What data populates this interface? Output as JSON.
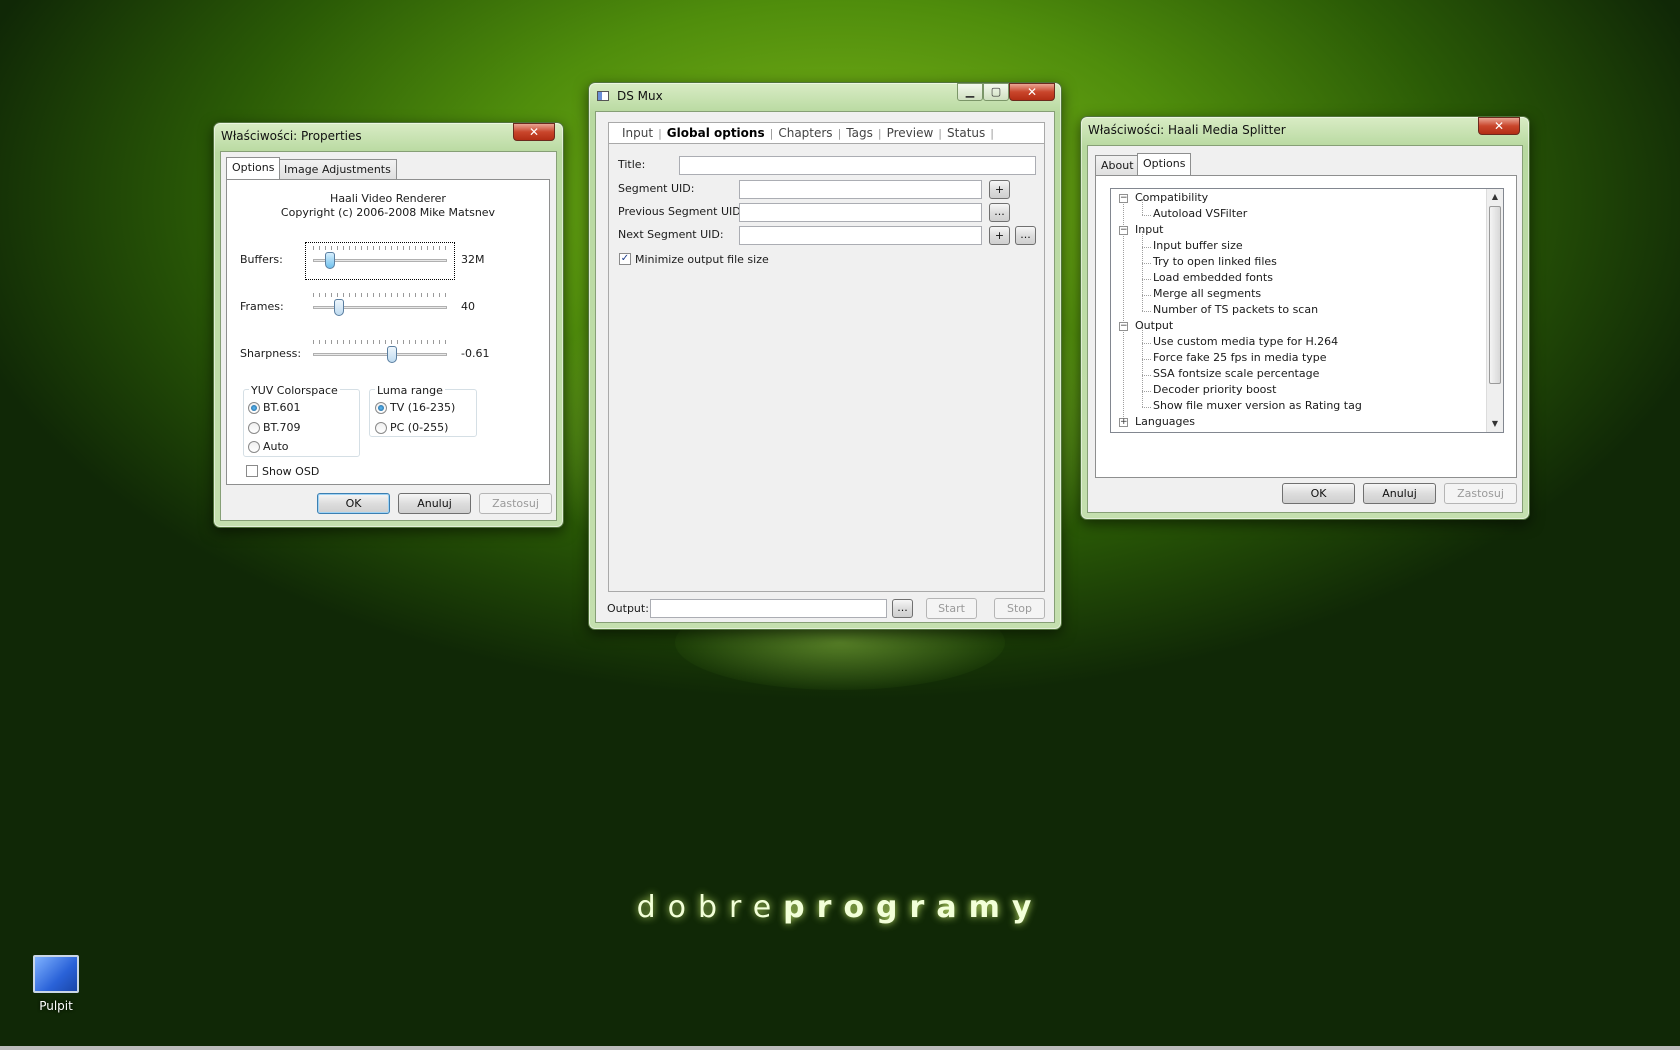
{
  "desktop": {
    "brand_part1": "dobre",
    "brand_part2": "programy",
    "icon_label": "Pulpit"
  },
  "properties_window": {
    "title": "Właściwości: Properties",
    "tabs": [
      "Options",
      "Image Adjustments"
    ],
    "header_line1": "Haali Video Renderer",
    "header_line2": "Copyright (c) 2006-2008 Mike Matsnev",
    "sliders": [
      {
        "label": "Buffers:",
        "value_text": "32M",
        "position": 0.1
      },
      {
        "label": "Frames:",
        "value_text": "40",
        "position": 0.17
      },
      {
        "label": "Sharpness:",
        "value_text": "-0.61",
        "position": 0.6
      }
    ],
    "yuv_group": {
      "label": "YUV Colorspace",
      "options": [
        "BT.601",
        "BT.709",
        "Auto"
      ],
      "selected": "BT.601"
    },
    "luma_group": {
      "label": "Luma range",
      "options": [
        "TV (16-235)",
        "PC (0-255)"
      ],
      "selected": "TV (16-235)"
    },
    "show_osd": {
      "label": "Show OSD",
      "checked": false
    },
    "buttons": {
      "ok": "OK",
      "cancel": "Anuluj",
      "apply": "Zastosuj"
    }
  },
  "dsmux_window": {
    "title": "DS Mux",
    "tabs": [
      "Input",
      "Global options",
      "Chapters",
      "Tags",
      "Preview",
      "Status"
    ],
    "active_tab": "Global options",
    "fields": {
      "title_label": "Title:",
      "segment_uid_label": "Segment UID:",
      "prev_segment_uid_label": "Previous Segment UID:",
      "next_segment_uid_label": "Next Segment UID:"
    },
    "plus": "+",
    "ellipsis": "...",
    "minimize": {
      "label": "Minimize output file size",
      "checked": true
    },
    "output_label": "Output:",
    "start": "Start",
    "stop": "Stop"
  },
  "haali_window": {
    "title": "Właściwości: Haali Media Splitter",
    "tabs": [
      "About",
      "Options"
    ],
    "tree": [
      {
        "label": "Compatibility",
        "level": 0,
        "expander": "−"
      },
      {
        "label": "Autoload VSFilter",
        "level": 1
      },
      {
        "label": "Input",
        "level": 0,
        "expander": "−"
      },
      {
        "label": "Input buffer size",
        "level": 1
      },
      {
        "label": "Try to open linked files",
        "level": 1
      },
      {
        "label": "Load embedded fonts",
        "level": 1
      },
      {
        "label": "Merge all segments",
        "level": 1
      },
      {
        "label": "Number of TS packets to scan",
        "level": 1
      },
      {
        "label": "Output",
        "level": 0,
        "expander": "−"
      },
      {
        "label": "Use custom media type for H.264",
        "level": 1
      },
      {
        "label": "Force fake 25 fps in media type",
        "level": 1
      },
      {
        "label": "SSA fontsize scale percentage",
        "level": 1
      },
      {
        "label": "Decoder priority boost",
        "level": 1
      },
      {
        "label": "Show file muxer version as Rating tag",
        "level": 1
      },
      {
        "label": "Languages",
        "level": 0,
        "expander": "+"
      }
    ],
    "buttons": {
      "ok": "OK",
      "cancel": "Anuluj",
      "apply": "Zastosuj"
    }
  }
}
